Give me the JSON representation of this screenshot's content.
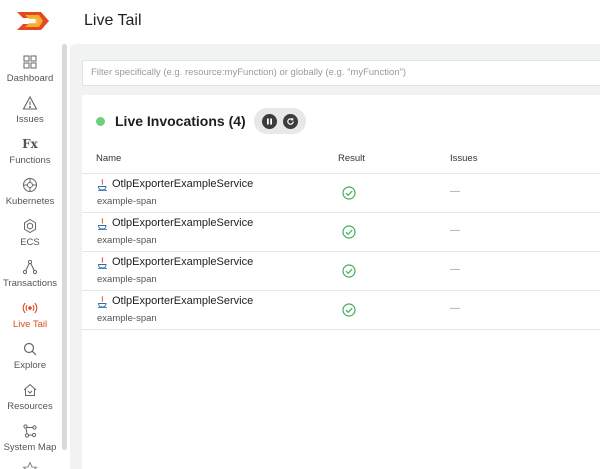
{
  "app": {
    "page_title": "Live Tail",
    "brand_color": "#e2491f"
  },
  "sidebar": {
    "items": [
      {
        "label": "Dashboard",
        "icon": "dashboard-icon"
      },
      {
        "label": "Issues",
        "icon": "warning-icon"
      },
      {
        "label": "Functions",
        "icon": "functions-icon",
        "glyph": "Fx"
      },
      {
        "label": "Kubernetes",
        "icon": "kubernetes-icon"
      },
      {
        "label": "ECS",
        "icon": "ecs-icon"
      },
      {
        "label": "Transactions",
        "icon": "transactions-icon"
      },
      {
        "label": "Live Tail",
        "icon": "live-tail-icon",
        "active": true
      },
      {
        "label": "Explore",
        "icon": "search-icon"
      },
      {
        "label": "Resources",
        "icon": "resources-icon"
      },
      {
        "label": "System Map",
        "icon": "system-map-icon"
      }
    ]
  },
  "filter": {
    "placeholder": "Filter specifically (e.g. resource:myFunction) or globally (e.g. \"myFunction\")"
  },
  "invocations": {
    "title": "Live Invocations (4)",
    "status_color": "#6fcf7f",
    "columns": {
      "name": "Name",
      "result": "Result",
      "issues": "Issues"
    },
    "rows": [
      {
        "service": "OtlpExporterExampleService",
        "span": "example-span",
        "result": "success",
        "issues": "—"
      },
      {
        "service": "OtlpExporterExampleService",
        "span": "example-span",
        "result": "success",
        "issues": "—"
      },
      {
        "service": "OtlpExporterExampleService",
        "span": "example-span",
        "result": "success",
        "issues": "—"
      },
      {
        "service": "OtlpExporterExampleService",
        "span": "example-span",
        "result": "success",
        "issues": "—"
      }
    ]
  }
}
